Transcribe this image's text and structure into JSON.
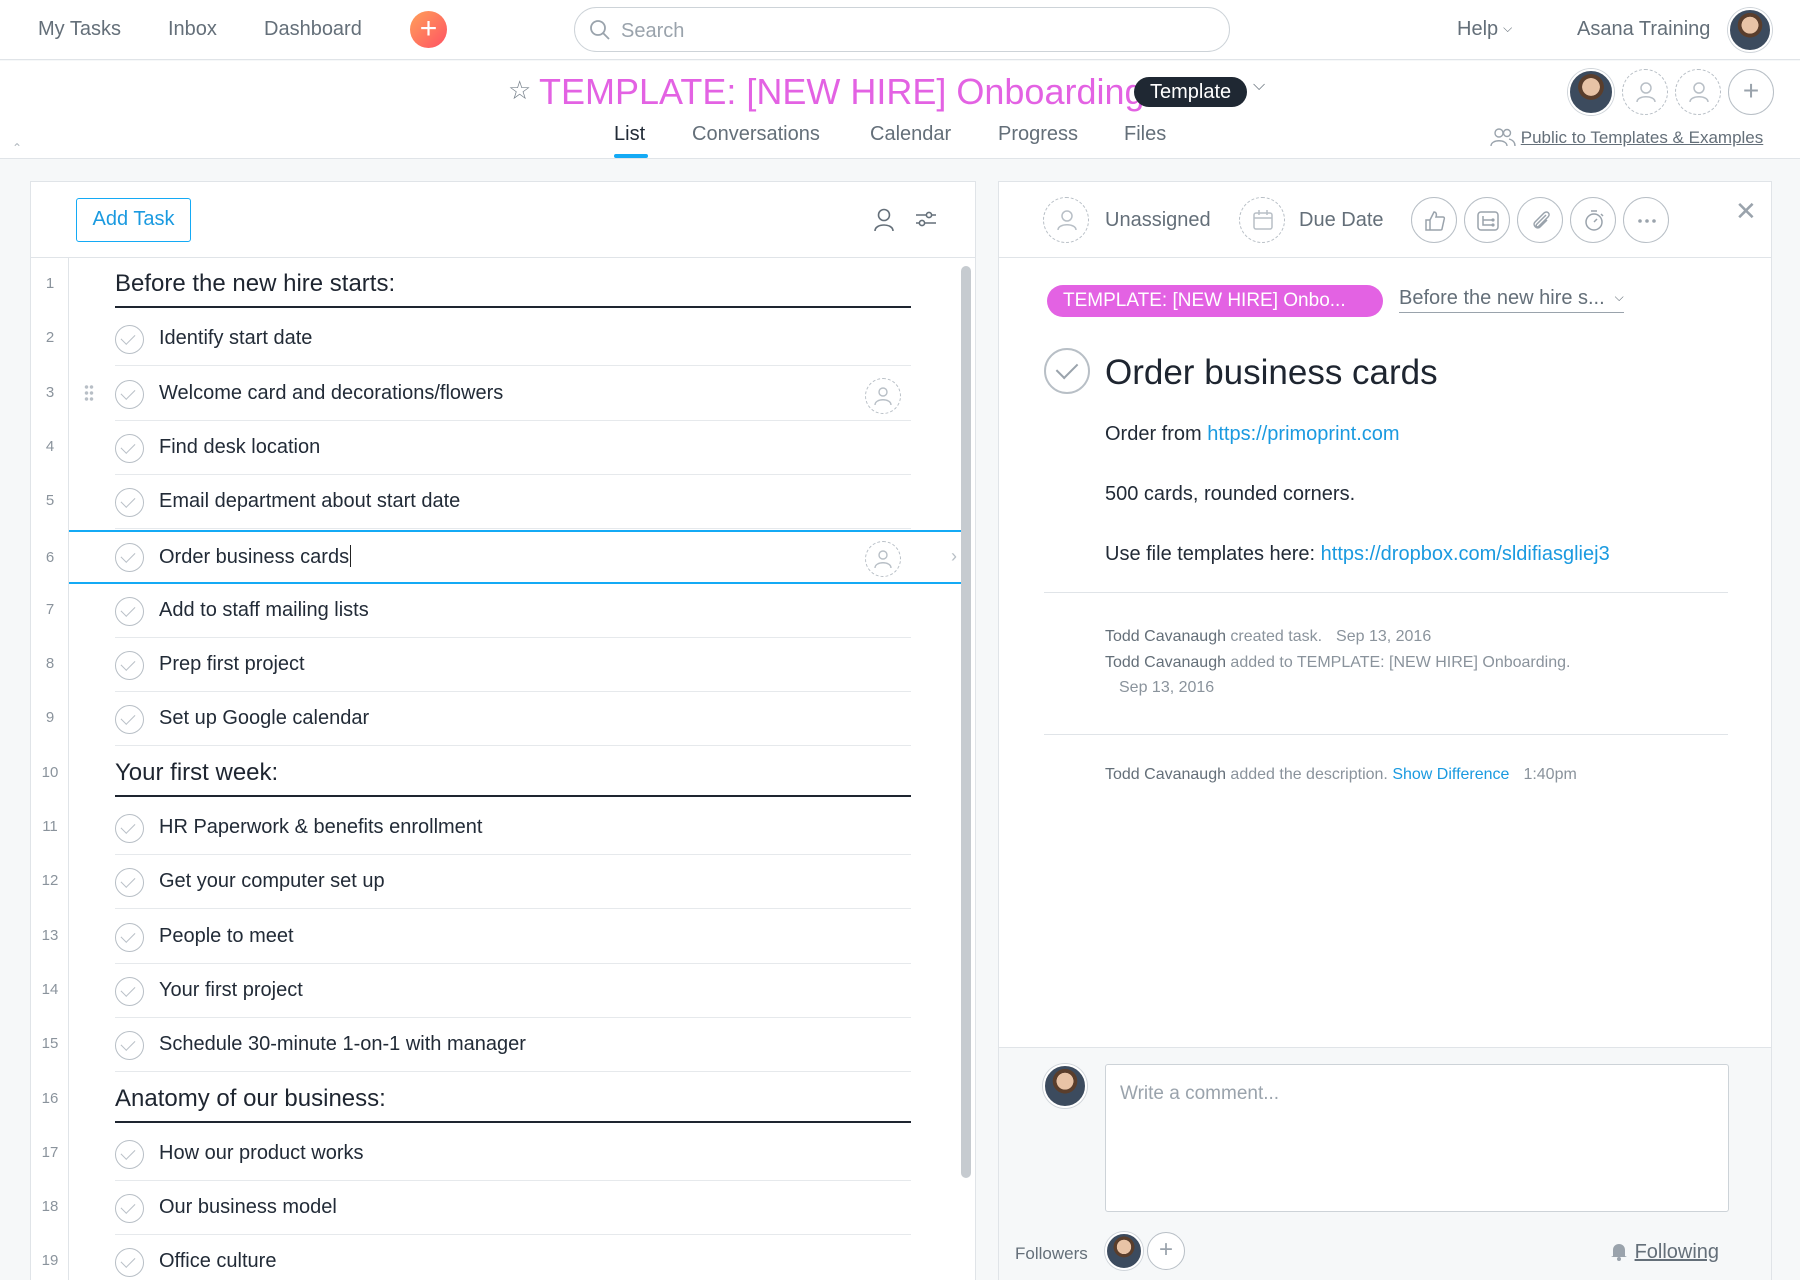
{
  "topbar": {
    "nav": [
      "My Tasks",
      "Inbox",
      "Dashboard"
    ],
    "quick_add": "+",
    "search_placeholder": "Search",
    "help": "Help",
    "user_name": "Asana Training"
  },
  "project": {
    "title": "TEMPLATE: [NEW HIRE] Onboarding",
    "badge": "Template",
    "tabs": [
      "List",
      "Conversations",
      "Calendar",
      "Progress",
      "Files"
    ],
    "active_tab": "List",
    "privacy": "Public to Templates & Examples",
    "add_member": "+"
  },
  "list": {
    "add_task_label": "Add Task",
    "rows": [
      {
        "num": "1",
        "type": "section",
        "name": "Before the new hire starts:"
      },
      {
        "num": "2",
        "type": "task",
        "name": "Identify start date"
      },
      {
        "num": "3",
        "type": "task",
        "name": "Welcome card and decorations/flowers",
        "hover": true
      },
      {
        "num": "4",
        "type": "task",
        "name": "Find desk location"
      },
      {
        "num": "5",
        "type": "task",
        "name": "Email department about start date"
      },
      {
        "num": "6",
        "type": "task",
        "name": "Order business cards",
        "selected": true
      },
      {
        "num": "7",
        "type": "task",
        "name": "Add to staff mailing lists"
      },
      {
        "num": "8",
        "type": "task",
        "name": "Prep first project"
      },
      {
        "num": "9",
        "type": "task",
        "name": "Set up Google calendar"
      },
      {
        "num": "10",
        "type": "section",
        "name": "Your first week:"
      },
      {
        "num": "11",
        "type": "task",
        "name": "HR Paperwork & benefits enrollment"
      },
      {
        "num": "12",
        "type": "task",
        "name": "Get your computer set up"
      },
      {
        "num": "13",
        "type": "task",
        "name": "People to meet"
      },
      {
        "num": "14",
        "type": "task",
        "name": "Your first project"
      },
      {
        "num": "15",
        "type": "task",
        "name": "Schedule 30-minute 1-on-1 with manager"
      },
      {
        "num": "16",
        "type": "section",
        "name": "Anatomy of our business:"
      },
      {
        "num": "17",
        "type": "task",
        "name": "How our product works"
      },
      {
        "num": "18",
        "type": "task",
        "name": "Our business model"
      },
      {
        "num": "19",
        "type": "task",
        "name": "Office culture"
      }
    ]
  },
  "detail": {
    "assignee": "Unassigned",
    "due_date": "Due Date",
    "project_pill": "TEMPLATE: [NEW HIRE] Onbo...",
    "section": "Before the new hire s...",
    "task_title": "Order business cards",
    "desc_1_text": "Order from ",
    "desc_1_link": "https://primoprint.com",
    "desc_2_text": "500 cards, rounded corners.",
    "desc_3_text": "Use file templates here: ",
    "desc_3_link": "https://dropbox.com/sldifiasgliej3",
    "story_1_actor": "Todd Cavanaugh",
    "story_1_action": " created task.",
    "story_1_date": "Sep 13, 2016",
    "story_2_actor": "Todd Cavanaugh",
    "story_2_action": " added to TEMPLATE: [NEW HIRE] Onboarding.",
    "story_2_date": "Sep 13, 2016",
    "story_3_actor": "Todd Cavanaugh",
    "story_3_action": " added the description. ",
    "story_3_link": "Show Difference",
    "story_3_time": "1:40pm",
    "comment_placeholder": "Write a comment...",
    "followers_label": "Followers",
    "add_follower": "+",
    "following_label": "Following"
  },
  "icons": {
    "search": "search-icon",
    "assignee": "person-icon",
    "calendar": "calendar-icon",
    "like": "thumbs-up-icon",
    "subtask": "subtask-icon",
    "attach": "paperclip-icon",
    "timer": "stopwatch-icon",
    "more": "more-icon",
    "close": "close-icon",
    "bell": "bell-icon"
  },
  "colors": {
    "accent_blue": "#14aaf5",
    "project_pink": "#e362e3",
    "quick_add_orange": "#ff7b5a"
  }
}
